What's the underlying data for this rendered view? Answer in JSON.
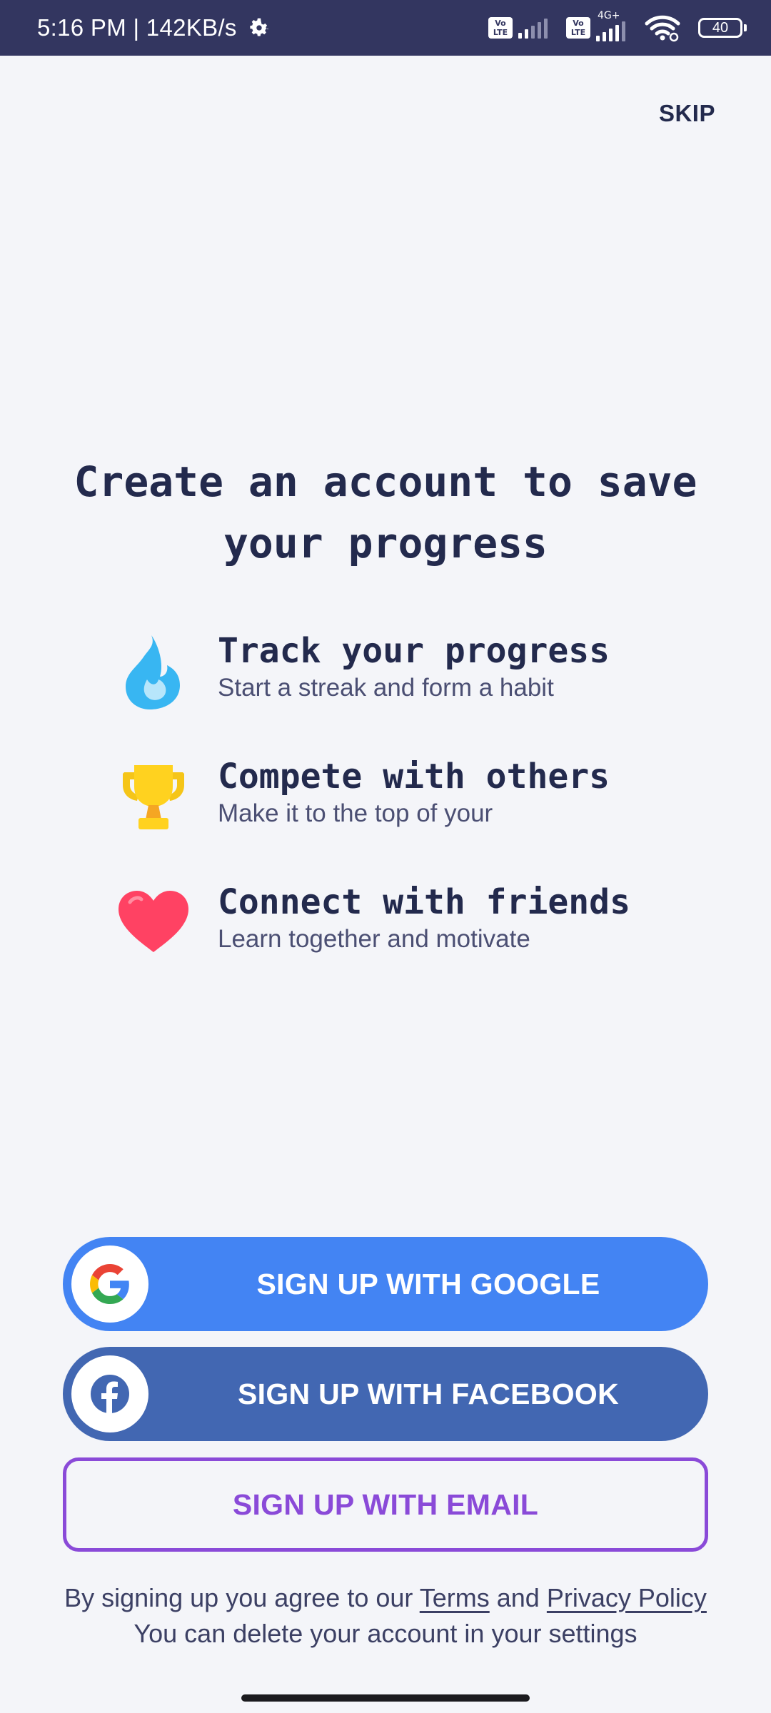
{
  "status_bar": {
    "time": "5:16 PM | 142KB/s",
    "volte_1": "Vo LTE",
    "volte_2": "Vo LTE",
    "network": "4G+",
    "battery": "40",
    "icons": [
      "gear-icon",
      "signal-icon",
      "wifi-icon",
      "battery-icon"
    ]
  },
  "header": {
    "skip_label": "SKIP"
  },
  "main": {
    "title": "Create an account to save your progress",
    "features": [
      {
        "icon": "flame-icon",
        "title": "Track your progress",
        "description": "Start a streak and form a habit"
      },
      {
        "icon": "trophy-icon",
        "title": "Compete with others",
        "description": "Make it to the top of your"
      },
      {
        "icon": "heart-icon",
        "title": "Connect with friends",
        "description": "Learn together and motivate"
      }
    ]
  },
  "buttons": {
    "google_label": "SIGN UP WITH GOOGLE",
    "facebook_label": "SIGN UP WITH FACEBOOK",
    "email_label": "SIGN UP WITH EMAIL"
  },
  "footer": {
    "agree_prefix": "By signing up you agree to our",
    "terms_link": "Terms",
    "and_text": "and",
    "privacy_link": "Privacy Policy",
    "delete_note": "You can delete your account in your settings"
  },
  "colors": {
    "background": "#f4f5f9",
    "status_bar": "#333660",
    "text_dark": "#232a4d",
    "google_blue": "#4384f3",
    "facebook_blue": "#4267b2",
    "email_purple": "#8a4ad8"
  }
}
